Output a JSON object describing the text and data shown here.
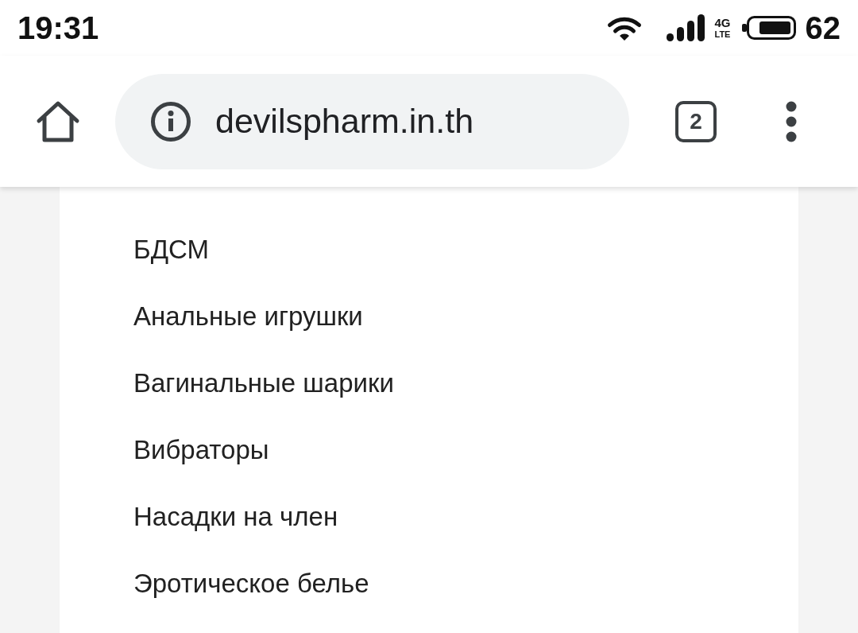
{
  "status_bar": {
    "time": "19:31",
    "network_type": "4G",
    "network_subtype": "LTE",
    "battery": "62"
  },
  "toolbar": {
    "url": "devilspharm.in.th",
    "tab_count": "2"
  },
  "menu": {
    "items": [
      {
        "label": "БДСМ"
      },
      {
        "label": "Анальные игрушки"
      },
      {
        "label": "Вагинальные шарики"
      },
      {
        "label": "Вибраторы"
      },
      {
        "label": "Насадки на член"
      },
      {
        "label": "Эротическое белье"
      }
    ]
  }
}
